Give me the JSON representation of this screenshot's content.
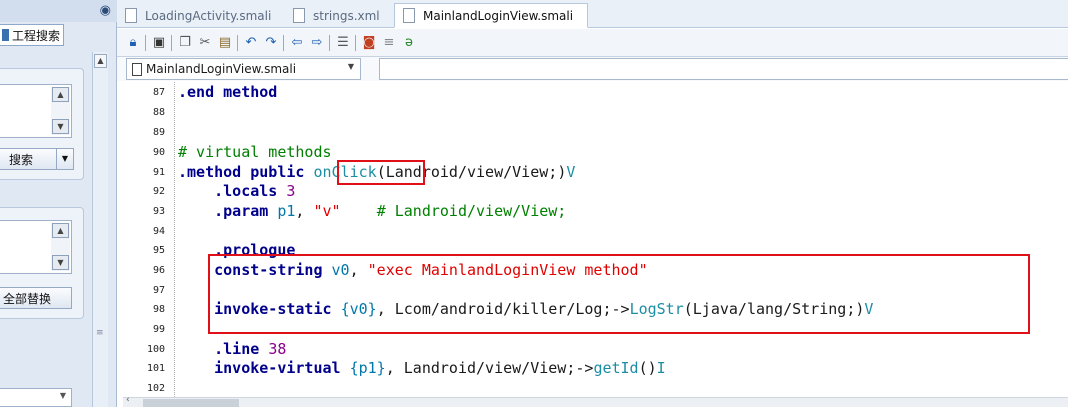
{
  "sidebar": {
    "tab_label": "工程搜索",
    "search_button": "搜索",
    "replace_all_button": "全部替换"
  },
  "tabs": [
    {
      "label": "LoadingActivity.smali",
      "active": false
    },
    {
      "label": "strings.xml",
      "active": false
    },
    {
      "label": "MainlandLoginView.smali",
      "active": true
    }
  ],
  "toolbar": {
    "icons": [
      "lock-icon",
      "save-icon",
      "copy-icon",
      "cut-icon",
      "paste-icon",
      "undo-icon",
      "redo-icon",
      "back-icon",
      "forward-icon",
      "format-icon",
      "java-icon",
      "list-icon",
      "flask-icon"
    ]
  },
  "address": {
    "file_selector": "MainlandLoginView.smali",
    "member_selector": ""
  },
  "editor": {
    "lines": [
      {
        "no": "87",
        "text": ".end method"
      },
      {
        "no": "88",
        "text": ""
      },
      {
        "no": "89",
        "text": ""
      },
      {
        "no": "90",
        "text": "# virtual methods"
      },
      {
        "no": "91",
        "text": ".method public onClick(Landroid/view/View;)V"
      },
      {
        "no": "92",
        "text": "    .locals 3"
      },
      {
        "no": "93",
        "text": "    .param p1, \"v\"    # Landroid/view/View;"
      },
      {
        "no": "94",
        "text": ""
      },
      {
        "no": "95",
        "text": "    .prologue"
      },
      {
        "no": "96",
        "text": "    const-string v0, \"exec MainlandLoginView method\""
      },
      {
        "no": "97",
        "text": ""
      },
      {
        "no": "98",
        "text": "    invoke-static {v0}, Lcom/android/killer/Log;->LogStr(Ljava/lang/String;)V"
      },
      {
        "no": "99",
        "text": ""
      },
      {
        "no": "100",
        "text": "    .line 38"
      },
      {
        "no": "101",
        "text": "    invoke-virtual {p1}, Landroid/view/View;->getId()I"
      },
      {
        "no": "102",
        "text": ""
      }
    ]
  },
  "colors": {
    "highlight_box": "#e01018",
    "keyword": "#00008b",
    "comment": "#008000",
    "string": "#e00000"
  }
}
